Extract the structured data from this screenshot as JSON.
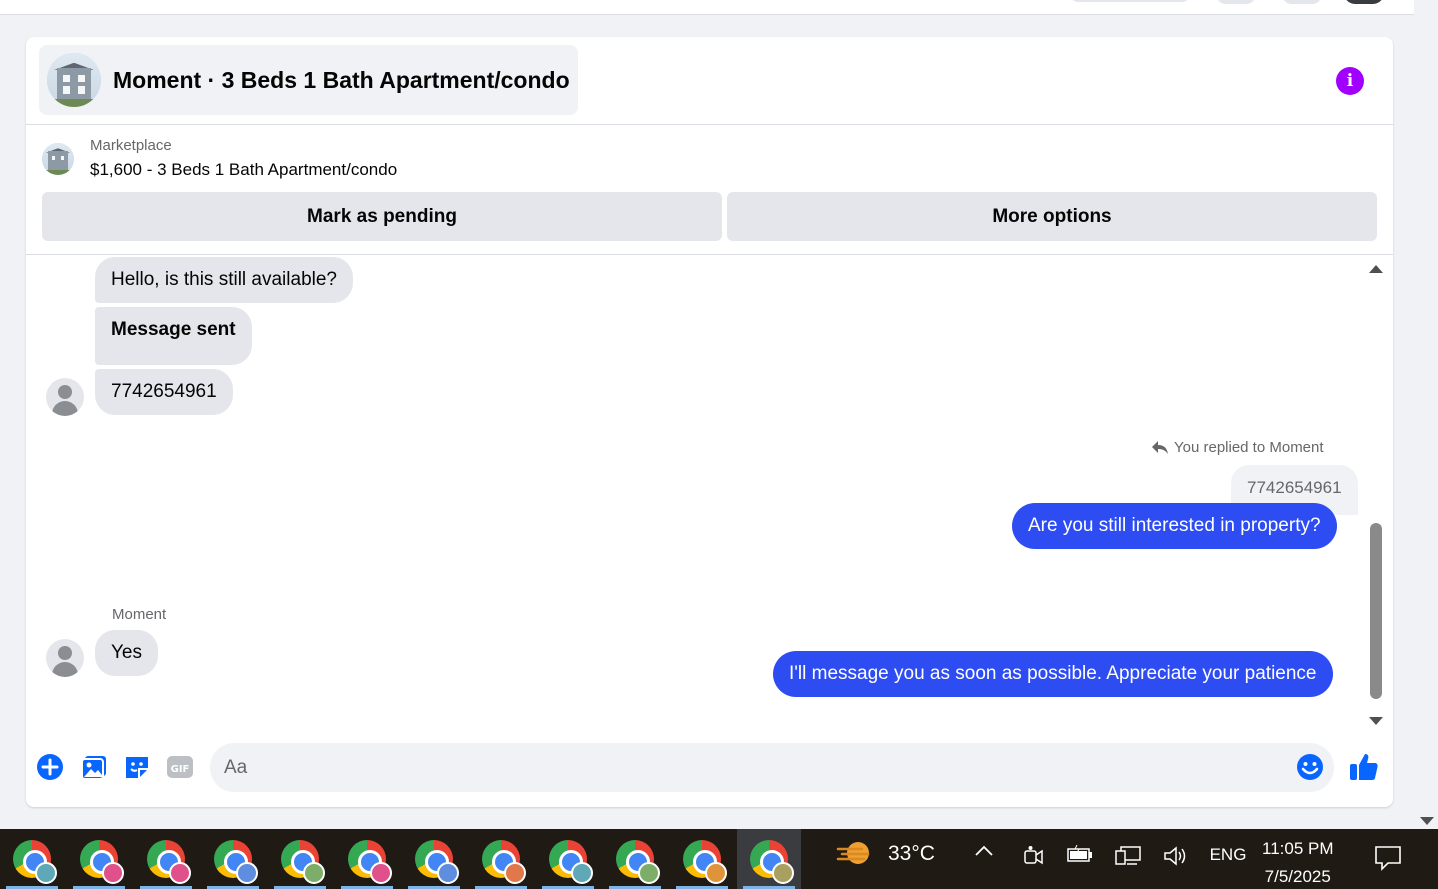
{
  "chat": {
    "title": "Moment · 3 Beds 1 Bath Apartment/condo",
    "marketplace_label": "Marketplace",
    "listing_line": "$1,600 - 3 Beds 1 Bath Apartment/condo",
    "btn_pending": "Mark as pending",
    "btn_more": "More options"
  },
  "messages": [
    {
      "from": "them",
      "text": "Hello, is this still available?"
    },
    {
      "from": "them",
      "text": "Message sent"
    },
    {
      "from": "them",
      "text": "7742654961"
    },
    {
      "from": "me",
      "reply_note": "You replied to Moment",
      "quoted": "7742654961",
      "text": "Are you still interested in property?"
    },
    {
      "from": "them",
      "sender": "Moment",
      "text": "Yes"
    },
    {
      "from": "me",
      "text": "I'll message you as soon as possible. Appreciate your patience"
    }
  ],
  "composer": {
    "placeholder": "Aa"
  },
  "colors": {
    "accent": "#2d4cf2",
    "info": "#a100ff",
    "icon_blue": "#0866ff"
  },
  "icons": [
    "plus-circle-icon",
    "photo-icon",
    "sticker-icon",
    "gif-icon",
    "emoji-icon",
    "thumbs-up-icon",
    "info-icon"
  ],
  "taskbar": {
    "weather": "33°C",
    "language": "ENG",
    "time": "11:05 PM",
    "date": "7/5/2025",
    "apps": [
      {
        "profile_color": "#5fa8b8"
      },
      {
        "profile_color": "#e0508a"
      },
      {
        "profile_color": "#e0508a"
      },
      {
        "profile_color": "#5f8de0"
      },
      {
        "profile_color": "#7cae6a"
      },
      {
        "profile_color": "#e0508a"
      },
      {
        "profile_color": "#5f8de0"
      },
      {
        "profile_color": "#e0784a"
      },
      {
        "profile_color": "#5fa8b8"
      },
      {
        "profile_color": "#7cae6a"
      },
      {
        "profile_color": "#e0943a"
      },
      {
        "profile_color": "#a8a060"
      }
    ]
  }
}
